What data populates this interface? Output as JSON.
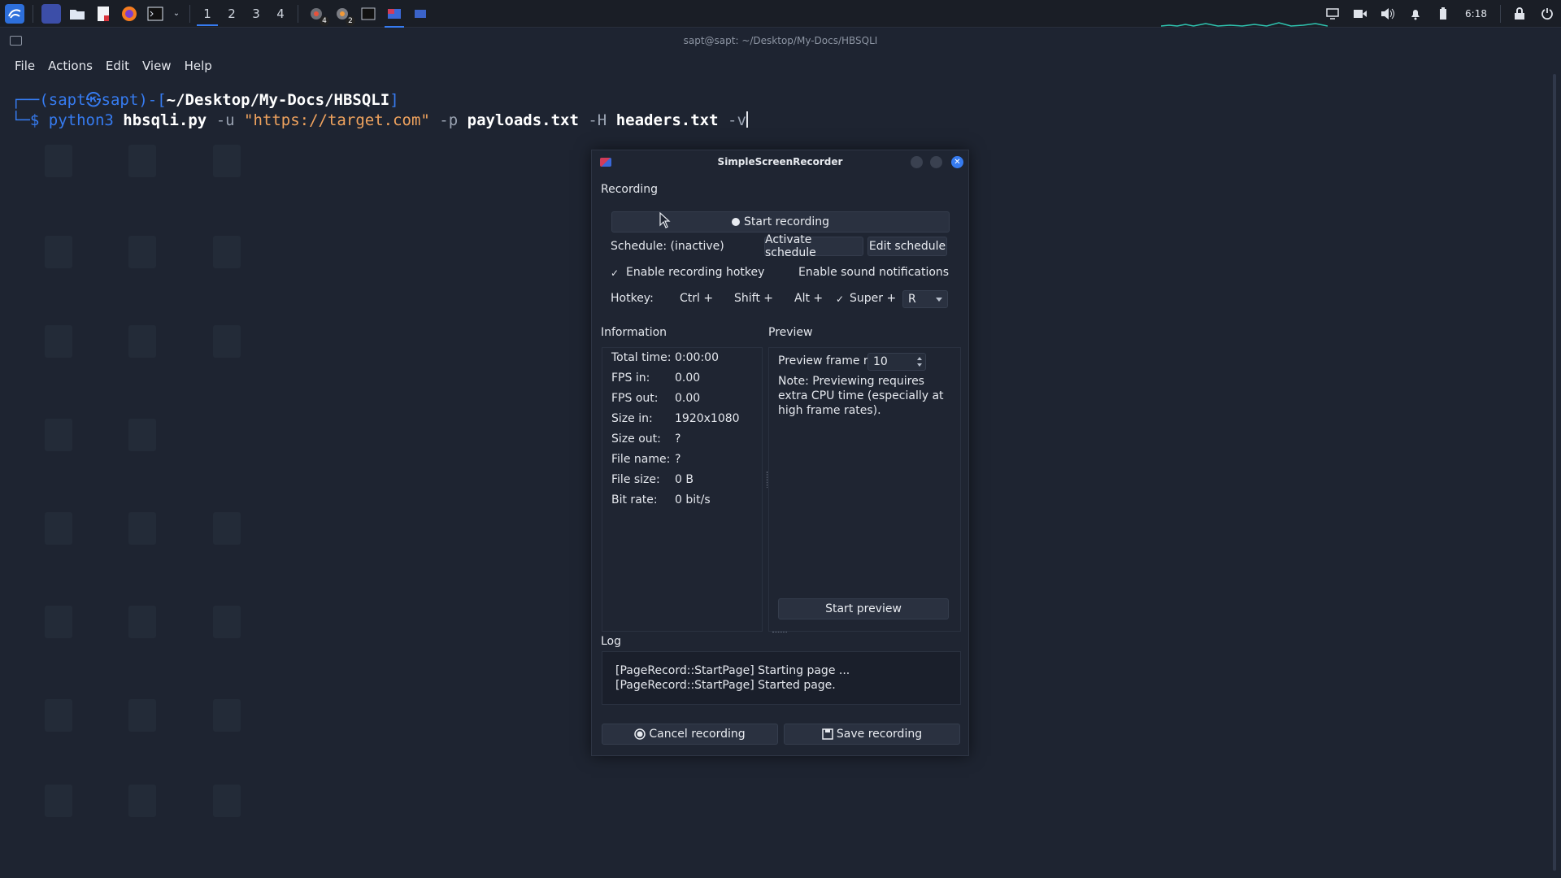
{
  "taskbar": {
    "workspaces": [
      "1",
      "2",
      "3",
      "4"
    ],
    "active_workspace": "1",
    "badges": {
      "task_a": "4",
      "task_b": "2"
    },
    "clock": "6:18"
  },
  "terminal": {
    "window_title": "sapt@sapt: ~/Desktop/My-Docs/HBSQLI",
    "menu": [
      "File",
      "Actions",
      "Edit",
      "View",
      "Help"
    ],
    "prompt_line_prefix": "┌──(",
    "prompt_user": "sapt",
    "prompt_at": "㉿",
    "prompt_host": "sapt",
    "prompt_mid": ")-[",
    "prompt_path": "~/Desktop/My-Docs/HBSQLI",
    "prompt_suffix": "]",
    "cmd_prefix": "└─$ ",
    "cmd": {
      "program": "python3",
      "script": "hbsqli.py",
      "opt_u": "-u",
      "url": "\"https://target.com\"",
      "opt_p": "-p",
      "payloads": "payloads.txt",
      "opt_h": "-H",
      "headers": "headers.txt",
      "opt_v": "-v"
    }
  },
  "recorder": {
    "title": "SimpleScreenRecorder",
    "recording_section": "Recording",
    "start_recording": "Start recording",
    "schedule_label": "Schedule: (inactive)",
    "activate_schedule": "Activate schedule",
    "edit_schedule": "Edit schedule",
    "enable_hotkey_label": "Enable recording hotkey",
    "enable_hotkey_checked": true,
    "enable_sound_label": "Enable sound notifications",
    "enable_sound_checked": false,
    "hotkey_label": "Hotkey:",
    "ctrl_label": "Ctrl +",
    "shift_label": "Shift +",
    "alt_label": "Alt +",
    "super_label": "Super +",
    "super_checked": true,
    "hotkey_key": "R",
    "information_section": "Information",
    "info": [
      {
        "key": "Total time:",
        "value": "0:00:00"
      },
      {
        "key": "FPS in:",
        "value": "0.00"
      },
      {
        "key": "FPS out:",
        "value": "0.00"
      },
      {
        "key": "Size in:",
        "value": "1920x1080"
      },
      {
        "key": "Size out:",
        "value": "?"
      },
      {
        "key": "File name:",
        "value": "?"
      },
      {
        "key": "File size:",
        "value": "0 B"
      },
      {
        "key": "Bit rate:",
        "value": "0 bit/s"
      }
    ],
    "preview_section": "Preview",
    "preview_frame_rate_label": "Preview frame rate:",
    "preview_frame_rate": "10",
    "preview_note": "Note: Previewing requires extra CPU time (especially at high frame rates).",
    "start_preview": "Start preview",
    "log_section": "Log",
    "log_lines": [
      "[PageRecord::StartPage] Starting page ...",
      "[PageRecord::StartPage] Started page."
    ],
    "cancel_recording": "Cancel recording",
    "save_recording": "Save recording"
  },
  "colors": {
    "accent": "#367bf0",
    "terminal_bg": "#1e2431",
    "string": "#f0a35e"
  }
}
